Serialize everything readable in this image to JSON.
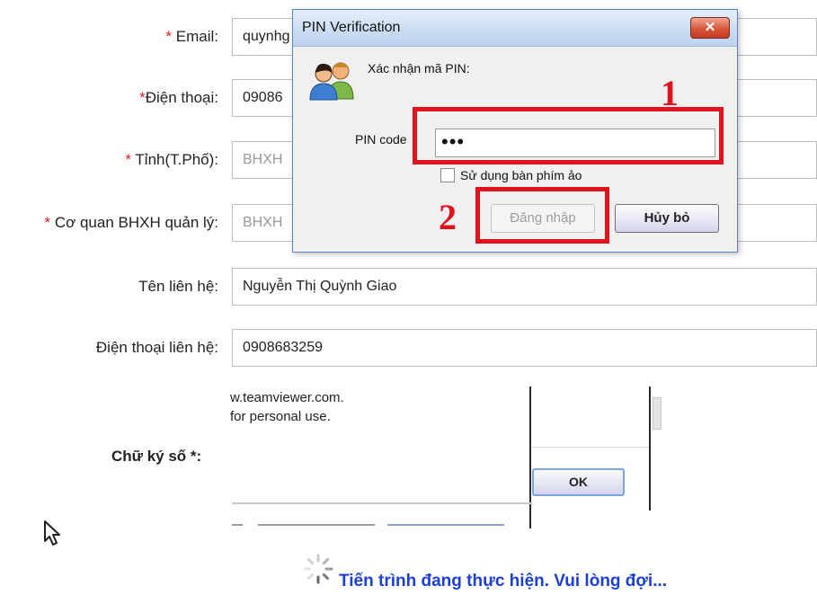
{
  "form": {
    "email": {
      "label": "Email:",
      "value": "quynhg"
    },
    "phone": {
      "label": "Điện thoại:",
      "value": "09086"
    },
    "province": {
      "label": "Tỉnh(T.Phố):",
      "value": "BHXH"
    },
    "agency": {
      "label": "Cơ quan BHXH quản lý:",
      "value": "BHXH"
    },
    "contact_name": {
      "label": "Tên liên hệ:",
      "value": "Nguyễn Thị Quỳnh Giao"
    },
    "contact_phone": {
      "label": "Điện thoại liên hệ:",
      "value": "0908683259"
    },
    "signature_label": "Chữ ký số *:",
    "required_mark": "*"
  },
  "teamviewer": {
    "line1": "w.teamviewer.com.",
    "line2": "for personal use.",
    "ok_label": "OK"
  },
  "progress": {
    "text": "Tiến trình đang thực hiện. Vui lòng đợi..."
  },
  "dialog": {
    "title": "PIN Verification",
    "close_glyph": "✕",
    "heading": "Xác nhận mã PIN:",
    "pin_label": "PIN code",
    "pin_value": "•••",
    "virtual_keyboard_label": "Sử dụng bàn phím ảo",
    "virtual_keyboard_checked": false,
    "login_label": "Đăng nhập",
    "cancel_label": "Hủy bỏ"
  },
  "annotations": {
    "step1": "1",
    "step2": "2",
    "color": "#e0141e"
  },
  "icons": [
    "users-icon",
    "close-icon",
    "spinner-icon",
    "mouse-cursor-icon"
  ]
}
